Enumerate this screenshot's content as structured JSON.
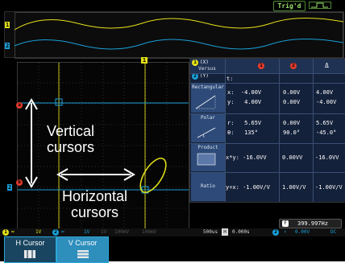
{
  "status": {
    "trigger": "Trig'd"
  },
  "channels": {
    "ch1": "1",
    "ch2": "2"
  },
  "cursor_panel": {
    "header": {
      "versus_top": "(X)",
      "versus_mid": "Versus",
      "versus_bot": "(Y)",
      "col_ch1": "1",
      "col_ch2": "2",
      "col_delta": "Δ",
      "t_label": "t:"
    },
    "rows": [
      {
        "name": "Rectangular",
        "lines": [
          "x:  -4.00V",
          "y:   4.00V"
        ],
        "ch2": [
          "0.00V",
          "0.00V"
        ],
        "delta": [
          "4.00V",
          "-4.00V"
        ]
      },
      {
        "name": "Polar",
        "lines": [
          "r:   5.65V",
          "θ:   135°"
        ],
        "ch2": [
          "0.00V",
          "90.0°"
        ],
        "delta": [
          "5.65V",
          "-45.0°"
        ]
      },
      {
        "name": "Product",
        "lines": [
          "x*y: -16.0VV"
        ],
        "ch2": [
          "0.00VV"
        ],
        "delta": [
          "-16.0VV"
        ]
      },
      {
        "name": "Ratio",
        "lines": [
          "y÷x: -1.00V/V"
        ],
        "ch2": [
          "1.00V/V"
        ],
        "delta": [
          "-1.00V/V"
        ]
      }
    ]
  },
  "annotations": {
    "vertical": "Vertical\ncursors",
    "horizontal": "Horizontal\ncursors"
  },
  "status_bar": {
    "ch1_scale": "1V",
    "ch2_scale": "1V",
    "dim_labels": [
      "1V",
      "100mV",
      "100mV",
      "1V",
      "100mV"
    ],
    "timebase": "500us",
    "delay": "0.000s",
    "trigger_level": "0.00V",
    "coupling": "DC"
  },
  "frequency": {
    "label": "399.997Hz"
  },
  "menu": {
    "h_cursor": "H Cursor",
    "v_cursor": "V Cursor"
  },
  "colors": {
    "ch1": "#e5e219",
    "ch2": "#1aa0d8",
    "cursor_red": "#e53b2a",
    "panel": "#14213a"
  }
}
